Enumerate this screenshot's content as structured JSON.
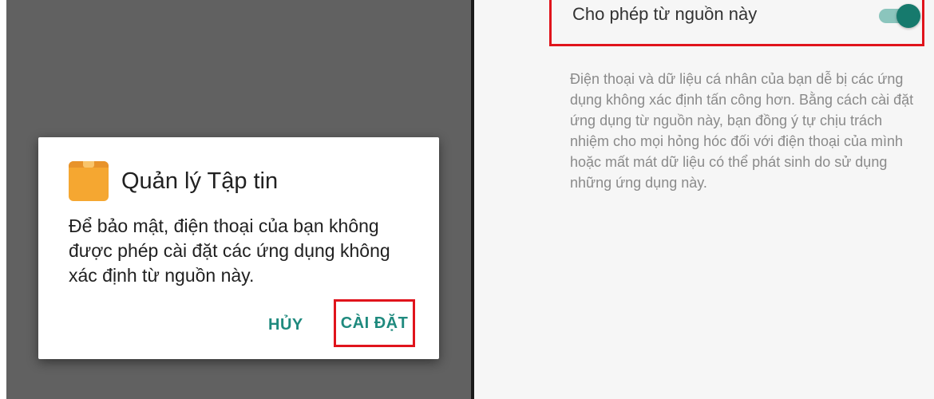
{
  "left": {
    "dialog": {
      "app_icon": "folder-icon",
      "title": "Quản lý Tập tin",
      "message": "Để bảo mật, điện thoại của bạn không được phép cài đặt các ứng dụng không xác định từ nguồn này.",
      "cancel_label": "HỦY",
      "install_label": "CÀI ĐẶT"
    }
  },
  "right": {
    "allow_label": "Cho phép từ nguồn này",
    "toggle_state": "on",
    "warning": "Điện thoại và dữ liệu cá nhân của bạn dễ bị các ứng dụng không xác định tấn công hơn. Bằng cách cài đặt ứng dụng từ nguồn này, bạn đồng ý tự chịu trách nhiệm cho mọi hỏng hóc đối với điện thoại của mình hoặc mất mát dữ liệu có thể phát sinh do sử dụng những ứng dụng này."
  },
  "colors": {
    "accent": "#1f8a7e",
    "highlight": "#e0141c",
    "dim_background": "#616161",
    "app_icon": "#f5a731"
  }
}
